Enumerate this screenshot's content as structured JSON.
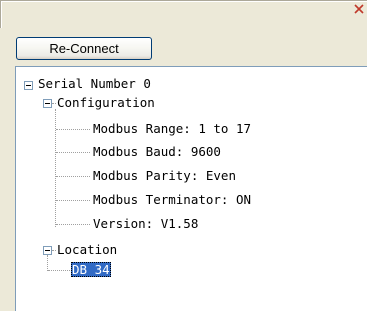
{
  "toolbar": {
    "reconnect_label": "Re-Connect"
  },
  "tree": {
    "root": "Serial Number 0",
    "configuration": {
      "label": "Configuration",
      "items": [
        "Modbus Range: 1 to 17",
        "Modbus Baud: 9600",
        "Modbus Parity: Even",
        "Modbus Terminator: ON",
        "Version: V1.58"
      ]
    },
    "location": {
      "label": "Location",
      "items": [
        "DB 34"
      ]
    }
  },
  "colors": {
    "selection": "#316ac5",
    "window": "#ece9d8"
  }
}
